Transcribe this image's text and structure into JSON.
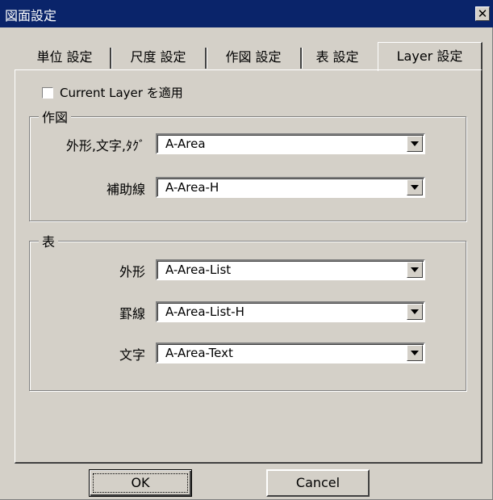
{
  "window": {
    "title": "図面設定"
  },
  "tabs": [
    "単位 設定",
    "尺度 設定",
    "作図 設定",
    "表 設定",
    "Layer 設定"
  ],
  "current_layer_checkbox": {
    "label": "Current Layer を適用",
    "checked": false
  },
  "drawing_group": {
    "title": "作図",
    "rows": [
      {
        "label": "外形,文字,ﾀｸﾞ",
        "value": "A-Area"
      },
      {
        "label": "補助線",
        "value": "A-Area-H"
      }
    ]
  },
  "table_group": {
    "title": "表",
    "rows": [
      {
        "label": "外形",
        "value": "A-Area-List"
      },
      {
        "label": "罫線",
        "value": "A-Area-List-H"
      },
      {
        "label": "文字",
        "value": "A-Area-Text"
      }
    ]
  },
  "buttons": {
    "ok": "OK",
    "cancel": "Cancel"
  }
}
